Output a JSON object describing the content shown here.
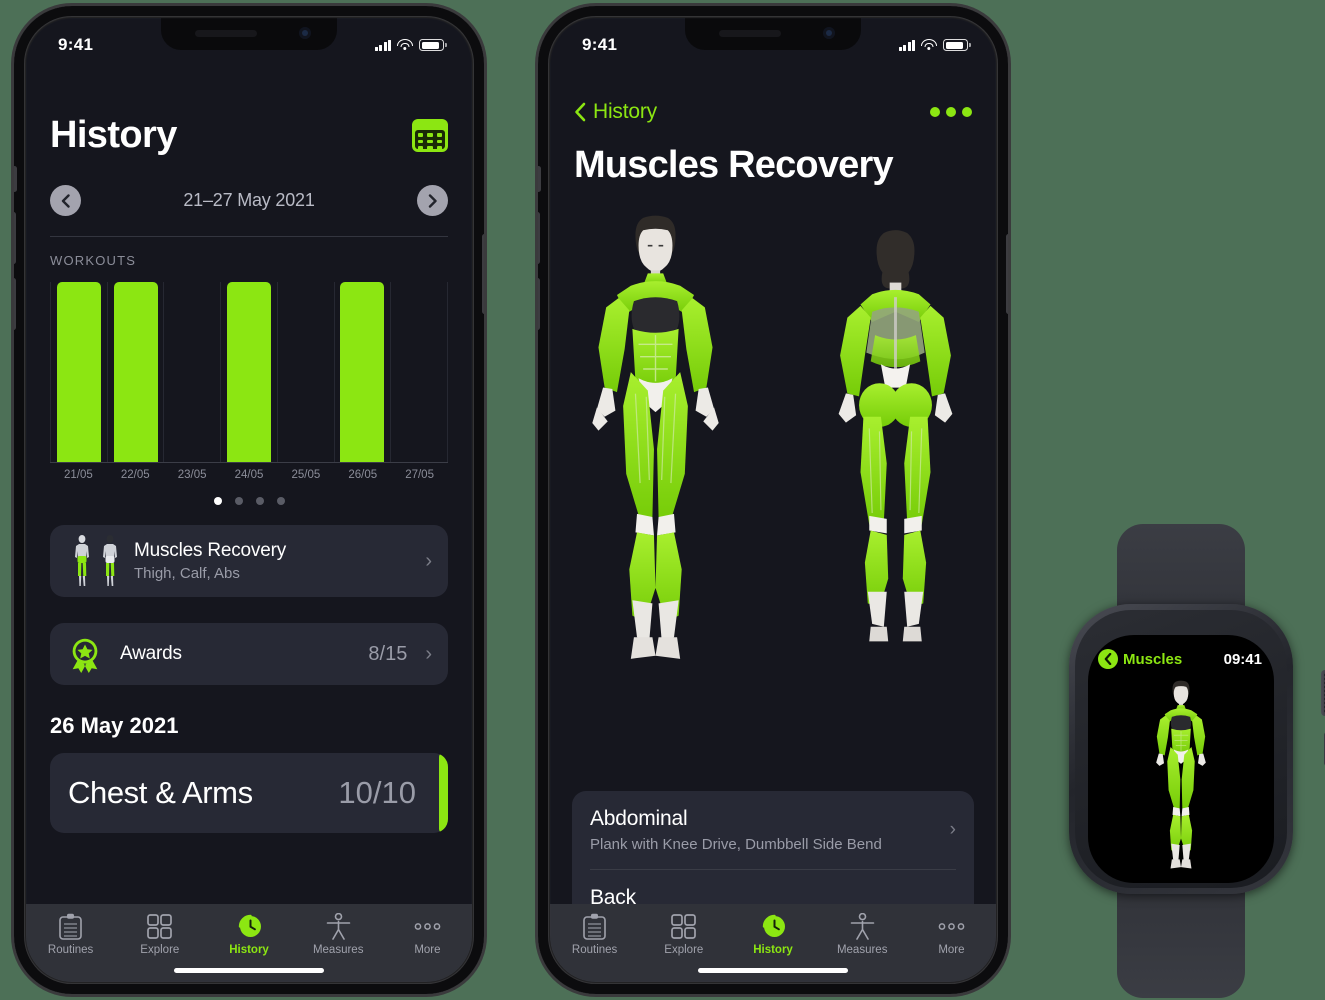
{
  "phone1": {
    "status": {
      "time": "9:41",
      "battery_icon": "battery-icon",
      "wifi_icon": "wifi-icon",
      "signal_icon": "cellular-signal-icon"
    },
    "header": {
      "title": "History",
      "calendar_icon": "calendar-icon"
    },
    "week_selector": {
      "prev_icon": "chevron-left-icon",
      "next_icon": "chevron-right-icon",
      "range": "21–27 May 2021"
    },
    "workouts_section_label": "WORKOUTS",
    "page_dots": {
      "count": 4,
      "active_index": 0
    },
    "rows": [
      {
        "title": "Muscles Recovery",
        "subtitle": "Thigh, Calf, Abs",
        "icon": "body-figures-icon",
        "chevron": "chevron-right-icon"
      },
      {
        "title": "Awards",
        "value": "8/15",
        "icon": "award-rosette-icon",
        "chevron": "chevron-right-icon"
      }
    ],
    "date_heading": "26 May 2021",
    "workout_card": {
      "name": "Chest & Arms",
      "value": "10/10",
      "accent": "#8ce612"
    }
  },
  "phone2": {
    "status": {
      "time": "9:41"
    },
    "navbar": {
      "back_label": "History",
      "back_icon": "chevron-left-icon",
      "more_icon": "more-horizontal-icon"
    },
    "title": "Muscles Recovery",
    "figures": [
      {
        "name": "front-body-figure"
      },
      {
        "name": "back-body-figure"
      }
    ],
    "muscle_list": [
      {
        "title": "Abdominal",
        "subtitle": "Plank with Knee Drive, Dumbbell Side Bend",
        "chevron": "chevron-right-icon"
      },
      {
        "title": "Back",
        "subtitle": "",
        "chevron": "chevron-right-icon"
      }
    ]
  },
  "tabbar": {
    "items": [
      {
        "label": "Routines",
        "icon": "clipboard-icon",
        "active": false
      },
      {
        "label": "Explore",
        "icon": "grid-icon",
        "active": false
      },
      {
        "label": "History",
        "icon": "clock-history-icon",
        "active": true
      },
      {
        "label": "Measures",
        "icon": "body-measure-icon",
        "active": false
      },
      {
        "label": "More",
        "icon": "more-dots-icon",
        "active": false
      }
    ]
  },
  "watch": {
    "back_label": "Muscles",
    "back_icon": "chevron-left-icon",
    "time": "09:41",
    "figure": "front-body-figure"
  },
  "colors": {
    "accent_green": "#8ce612",
    "screen_bg": "#15161e",
    "card_bg": "#272935",
    "tabbar_bg": "#303239",
    "muted_text": "#9a9ca8",
    "page_bg": "#4d7057"
  },
  "chart_data": {
    "type": "bar",
    "title": "WORKOUTS",
    "categories": [
      "21/05",
      "22/05",
      "23/05",
      "24/05",
      "25/05",
      "26/05",
      "27/05"
    ],
    "values": [
      1,
      1,
      0,
      1,
      0,
      1,
      0
    ],
    "xlabel": "",
    "ylabel": "",
    "ylim": [
      0,
      1
    ],
    "grid": true,
    "legend": "none",
    "bar_color": "#8ce612"
  }
}
